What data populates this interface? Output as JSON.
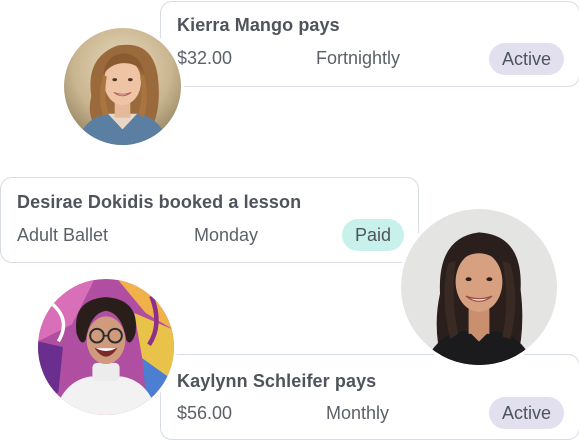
{
  "cards": [
    {
      "title": "Kierra Mango pays",
      "amount": "$32.00",
      "frequency": "Fortnightly",
      "status": "Active"
    },
    {
      "title": "Desirae Dokidis booked a lesson",
      "class_name": "Adult Ballet",
      "day": "Monday",
      "status": "Paid"
    },
    {
      "title": "Kaylynn Schleifer pays",
      "amount": "$56.00",
      "frequency": "Monthly",
      "status": "Active"
    }
  ],
  "colors": {
    "active_badge": "#e2e0ef",
    "paid_badge": "#c8f1ec",
    "card_border": "#d8dce3"
  }
}
